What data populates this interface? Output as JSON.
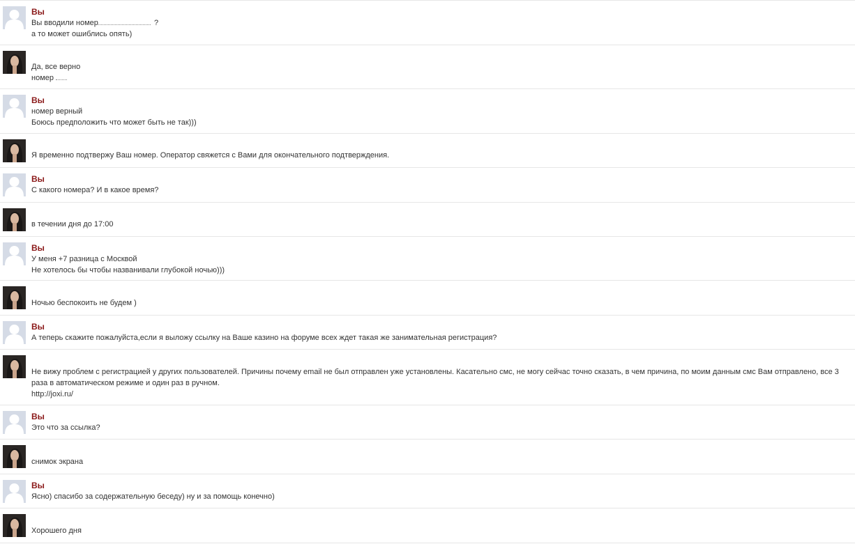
{
  "messages": [
    {
      "side": "user",
      "author": "Вы",
      "lines": [
        "Вы вводили номер",
        "?",
        "а то может ошиблись опять)"
      ]
    },
    {
      "side": "agent",
      "author": "",
      "lines": [
        "Да, все верно",
        "номер"
      ]
    },
    {
      "side": "user",
      "author": "Вы",
      "lines": [
        "номер верный",
        "Боюсь предположить что может быть не так)))"
      ]
    },
    {
      "side": "agent",
      "author": "",
      "lines": [
        "Я временно подтвержу Ваш номер. Оператор свяжется с Вами для окончательного подтверждения."
      ]
    },
    {
      "side": "user",
      "author": "Вы",
      "lines": [
        "С какого номера? И в какое время?"
      ]
    },
    {
      "side": "agent",
      "author": "",
      "lines": [
        "в течении дня до 17:00"
      ]
    },
    {
      "side": "user",
      "author": "Вы",
      "lines": [
        "У меня +7 разница с Москвой",
        "Не хотелось бы чтобы названивали глубокой ночью)))"
      ]
    },
    {
      "side": "agent",
      "author": "",
      "lines": [
        "Ночью беспокоить не будем )"
      ]
    },
    {
      "side": "user",
      "author": "Вы",
      "lines": [
        "А теперь скажите пожалуйста,если я выложу ссылку на Ваше казино на форуме всех ждет такая же занимательная регистрация?"
      ]
    },
    {
      "side": "agent",
      "author": "",
      "lines": [
        "Не вижу проблем с регистрацией у других пользователей. Причины почему email не был отправлен уже установлены. Касательно смс, не могу сейчас точно сказать, в чем причина, по моим данным смс Вам отправлено, все 3 раза в автоматическом режиме и один раз в ручном.",
        "http://joxi.ru/"
      ]
    },
    {
      "side": "user",
      "author": "Вы",
      "lines": [
        "Это что за ссылка?"
      ]
    },
    {
      "side": "agent",
      "author": "",
      "lines": [
        "снимок экрана"
      ]
    },
    {
      "side": "user",
      "author": "Вы",
      "lines": [
        "Ясно) спасибо за содержательную беседу) ну и за помощь конечно)"
      ]
    },
    {
      "side": "agent",
      "author": "",
      "lines": [
        "Хорошего дня"
      ]
    }
  ]
}
